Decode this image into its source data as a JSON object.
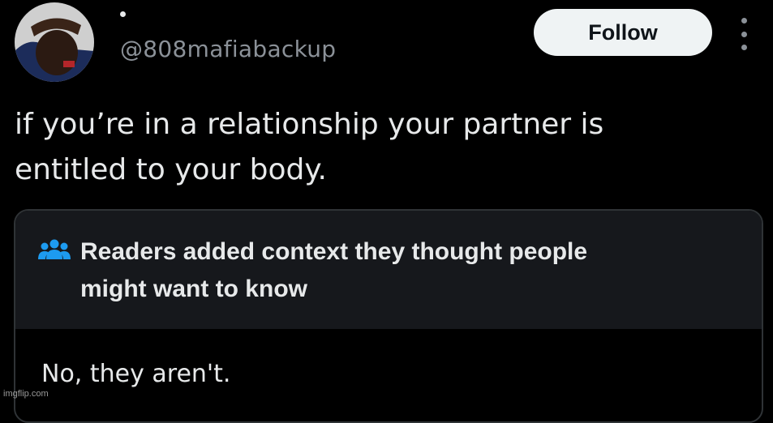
{
  "header": {
    "handle": "@808mafiabackup",
    "avatar_icon": "user-avatar-photo",
    "follow_label": "Follow",
    "more_icon": "vertical-ellipsis-icon"
  },
  "tweet": {
    "line1": "if you’re in a relationship your partner is",
    "line2": "entitled to your body."
  },
  "community_note": {
    "icon": "people-group-icon",
    "title_line1": "Readers added context they thought people",
    "title_line2": "might want to know",
    "body": "No, they aren't."
  },
  "watermark": "imgflip.com",
  "colors": {
    "background": "#000000",
    "text": "#e7e9ea",
    "secondary_text": "#8b9198",
    "follow_button_bg": "#eff3f4",
    "note_header_bg": "#16181c",
    "note_border": "#2f3336",
    "note_icon": "#1d9bf0"
  }
}
